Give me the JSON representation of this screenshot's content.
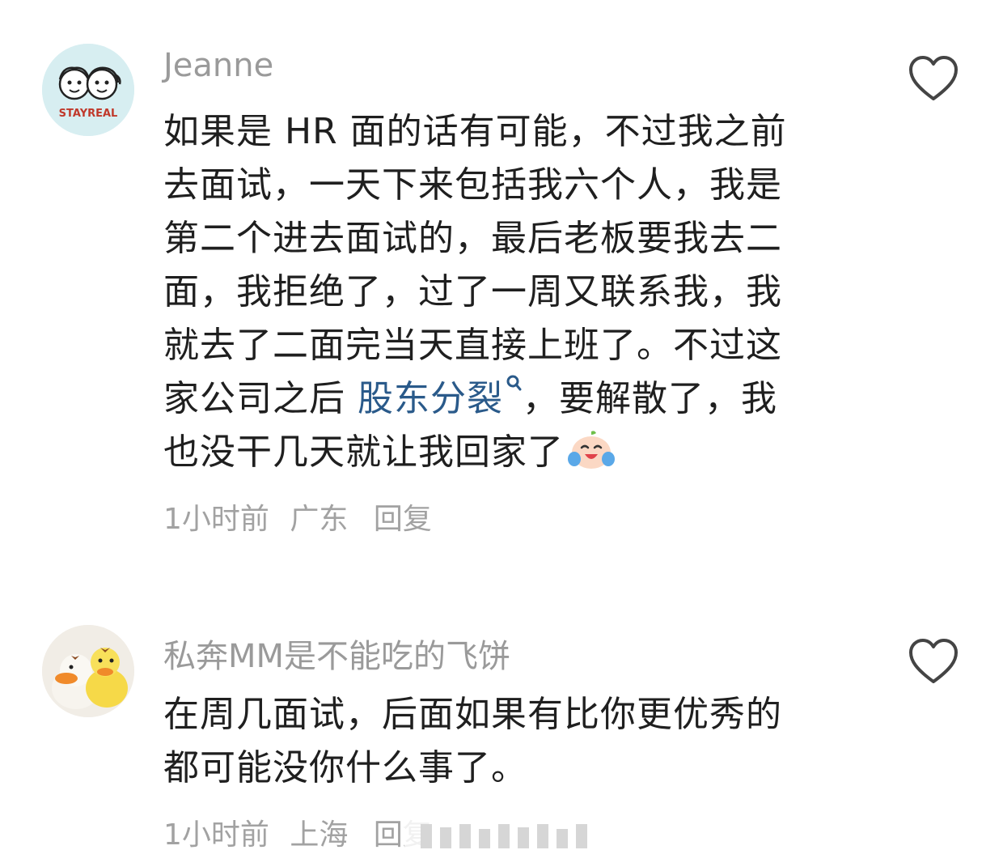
{
  "comments": [
    {
      "username": "Jeanne",
      "avatar_text": "STAYREAL",
      "lines": [
        "如果是 HR 面的话有可能，不过我之前",
        "去面试，一天下来包括我六个人，我是",
        "第二个进去面试的，最后老板要我去二",
        "面，我拒绝了，过了一周又联系我，我",
        "就去了二面完当天直接上班了。不过这"
      ],
      "line6_before": "家公司之后 ",
      "link_text": "股东分裂",
      "line6_after": "，要解散了，我",
      "line7": "也没干几天就让我回家了",
      "time": "1小时前",
      "location": "广东",
      "reply_label": "回复",
      "icons": {
        "like": "heart-outline-icon",
        "search": "magnifier-icon",
        "emoji": "crying-laughing-emoji"
      }
    },
    {
      "username": "私奔MM是不能吃的飞饼",
      "lines": [
        "在周几面试，后面如果有比你更优秀的",
        "都可能没你什么事了。"
      ],
      "time": "1小时前",
      "location": "上海",
      "reply_label": "回复",
      "icons": {
        "like": "heart-outline-icon"
      }
    }
  ],
  "colors": {
    "text": "#1f1f1f",
    "muted": "#9a9a9a",
    "link": "#2a5a8a"
  }
}
